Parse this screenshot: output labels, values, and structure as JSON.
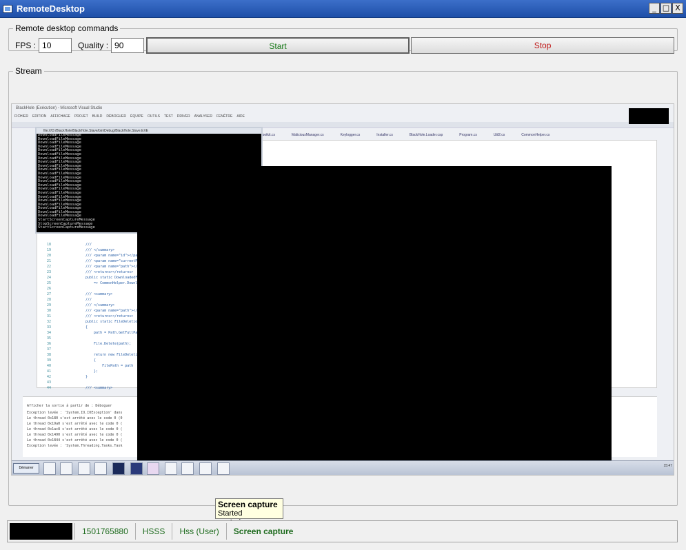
{
  "window": {
    "title": "RemoteDesktop",
    "minimize": "_",
    "maximize": "□",
    "close": "X"
  },
  "commands": {
    "legend": "Remote desktop commands",
    "fps_label": "FPS :",
    "fps_value": "10",
    "quality_label": "Quality :",
    "quality_value": "90",
    "start_label": "Start",
    "stop_label": "Stop",
    "start_color": "#1a7a1a",
    "stop_color": "#c01818"
  },
  "stream": {
    "legend": "Stream",
    "screen": {
      "vs_title": "BlackHole (Exécution) - Microsoft Visual Studio",
      "menu": [
        "FICHIER",
        "EDITION",
        "AFFICHAGE",
        "PROJET",
        "BUILD",
        "DÉBOGUER",
        "ÉQUIPE",
        "OUTILS",
        "TEST",
        "DRIVER",
        "ANALYSER",
        "FENÊTRE",
        "AIDE"
      ],
      "tabs": [
        "Rootkit.cs",
        "MaliciousManager.cs",
        "Keylogger.cs",
        "Installer.cs",
        "BlackHole.Loader.csp",
        "Program.cs",
        "Util2.cs",
        "CommonHelper.cs"
      ],
      "console_title": "file:///D:/BlackHole/BlackHole.Slave/bin/Debug/BlackHole.Slave.EXE",
      "console_lines": [
        "DownloadFileMessage",
        "DownloadFileMessage",
        "DownloadFileMessage",
        "DownloadFileMessage",
        "DownloadFileMessage",
        "DownloadFileMessage",
        "DownloadFileMessage",
        "DownloadFileMessage",
        "DownloadFileMessage",
        "DownloadFileMessage",
        "DownloadFileMessage",
        "DownloadFileMessage",
        "DownloadFileMessage",
        "DownloadFileMessage",
        "DownloadFileMessage",
        "DownloadFileMessage",
        "DownloadFileMessage",
        "DownloadFileMessage",
        "DownloadFileMessage",
        "DownloadFileMessage",
        "DownloadFileMessage",
        "DownloadFileMessage",
        "StartScreenCaptureMessage",
        "StopScreenCaptureMessage",
        "StartScreenCaptureMessage"
      ],
      "code_lines": [
        {
          "n": "18",
          "t": "///"
        },
        {
          "n": "19",
          "t": "/// </summary>"
        },
        {
          "n": "20",
          "t": "/// <param name=\"id\"></par"
        },
        {
          "n": "21",
          "t": "/// <param name=\"currentP"
        },
        {
          "n": "22",
          "t": "/// <param name=\"path\"></"
        },
        {
          "n": "23",
          "t": "/// <returns></returns>"
        },
        {
          "n": "24",
          "t": "public static DownloadedFi"
        },
        {
          "n": "25",
          "t": "    => CommonHelper.Downl"
        },
        {
          "n": "26",
          "t": ""
        },
        {
          "n": "27",
          "t": "/// <summary>"
        },
        {
          "n": "28",
          "t": "///"
        },
        {
          "n": "29",
          "t": "/// </summary>"
        },
        {
          "n": "30",
          "t": "/// <param name=\"path\"></"
        },
        {
          "n": "31",
          "t": "/// <returns></returns>"
        },
        {
          "n": "32",
          "t": "public static FileDeletio"
        },
        {
          "n": "33",
          "t": "{"
        },
        {
          "n": "34",
          "t": "    path = Path.GetFullPat"
        },
        {
          "n": "35",
          "t": ""
        },
        {
          "n": "36",
          "t": "    File.Delete(path);"
        },
        {
          "n": "37",
          "t": ""
        },
        {
          "n": "38",
          "t": "    return new FileDeletio"
        },
        {
          "n": "39",
          "t": "    {"
        },
        {
          "n": "40",
          "t": "        FilePath = path"
        },
        {
          "n": "41",
          "t": "    };"
        },
        {
          "n": "42",
          "t": "}"
        },
        {
          "n": "43",
          "t": ""
        },
        {
          "n": "44",
          "t": "/// <summary>"
        }
      ],
      "output_header": "Afficher la sortie à partir de : Déboguer",
      "output_lines": [
        "Exception levée : 'System.IO.IOException' dans",
        "Le thread 0x180 s'est arrêté avec le code 0 (0",
        "Le thread 0x19a0 s'est arrêté avec le code 0 (",
        "Le thread 0x1ac8 s'est arrêté avec le code 0 (",
        "Le thread 0x1490 s'est arrêté avec le code 0 (",
        "Le thread 0x1844 s'est arrêté avec le code 0 (",
        "Exception levée : 'System.Threading.Tasks.Task"
      ],
      "start_button": "Démarrer",
      "clock": "15:47"
    }
  },
  "tooltip": {
    "title": "Screen capture",
    "text": "Started capturing..."
  },
  "statusbar": {
    "id": "1501765880",
    "machine": "HSSS",
    "user": "Hss (User)",
    "activity": "Screen capture"
  }
}
